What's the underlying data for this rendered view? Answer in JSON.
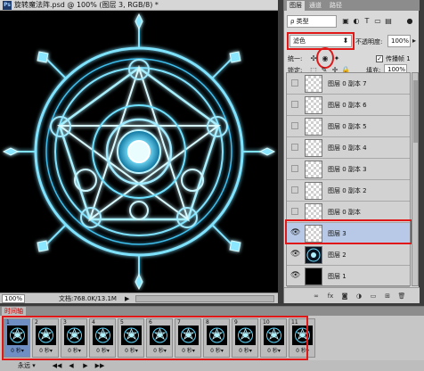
{
  "document": {
    "app_icon": "Ps",
    "title": "旋转魔法阵.psd @ 100% (图层 3, RGB/8) *",
    "zoom": "100%",
    "doc_size": "文档:768.0K/13.1M"
  },
  "layers_panel": {
    "tabs": [
      "图层",
      "通道",
      "路径"
    ],
    "filter_kind": "ρ 类型",
    "blend_mode": "滤色",
    "opacity_label": "不透明度:",
    "opacity_value": "100%",
    "unify_label": "统一:",
    "propagate_label": "传播帧 1",
    "lock_label": "锁定:",
    "fill_label": "填充:",
    "fill_value": "100%",
    "layers": [
      {
        "name": "图层 0 副本 7",
        "visible": false,
        "thumb": "transparent",
        "selected": false
      },
      {
        "name": "图层 0 副本 6",
        "visible": false,
        "thumb": "transparent",
        "selected": false
      },
      {
        "name": "图层 0 副本 5",
        "visible": false,
        "thumb": "transparent",
        "selected": false
      },
      {
        "name": "图层 0 副本 4",
        "visible": false,
        "thumb": "transparent",
        "selected": false
      },
      {
        "name": "图层 0 副本 3",
        "visible": false,
        "thumb": "transparent",
        "selected": false
      },
      {
        "name": "图层 0 副本 2",
        "visible": false,
        "thumb": "transparent",
        "selected": false
      },
      {
        "name": "图层 0 副本",
        "visible": false,
        "thumb": "transparent",
        "selected": false
      },
      {
        "name": "图层 3",
        "visible": true,
        "thumb": "transparent",
        "selected": true
      },
      {
        "name": "图层 2",
        "visible": true,
        "thumb": "star",
        "selected": false
      },
      {
        "name": "图层 1",
        "visible": true,
        "thumb": "black",
        "selected": false
      }
    ],
    "footer_icons": [
      "link-icon",
      "fx-icon",
      "mask-icon",
      "adjustment-icon",
      "group-icon",
      "new-layer-icon",
      "delete-icon"
    ]
  },
  "timeline": {
    "tab_label": "时间轴",
    "frames": [
      {
        "num": "1",
        "delay": "0 秒▾"
      },
      {
        "num": "2",
        "delay": "0 秒▾"
      },
      {
        "num": "3",
        "delay": "0 秒▾"
      },
      {
        "num": "4",
        "delay": "0 秒▾"
      },
      {
        "num": "5",
        "delay": "0 秒▾"
      },
      {
        "num": "6",
        "delay": "0 秒▾"
      },
      {
        "num": "7",
        "delay": "0 秒▾"
      },
      {
        "num": "8",
        "delay": "0 秒▾"
      },
      {
        "num": "9",
        "delay": "0 秒▾"
      },
      {
        "num": "10",
        "delay": "0 秒▾"
      },
      {
        "num": "11",
        "delay": "0 秒▾"
      }
    ],
    "loop": "永远 ▾",
    "controls": [
      "◀◀",
      "◀",
      "▶",
      "▶▶"
    ]
  },
  "colors": {
    "highlight_red": "#e01818",
    "selected_layer": "#b7c9e6",
    "glow_cyan": "#3fd7ff"
  }
}
